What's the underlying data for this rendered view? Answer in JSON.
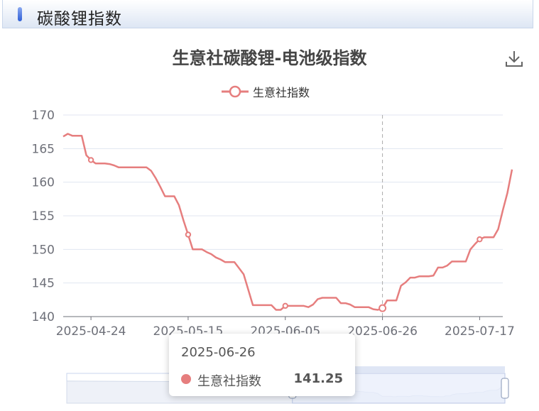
{
  "panel": {
    "title": "碳酸锂指数"
  },
  "toolbar": {
    "download_icon": "download-icon"
  },
  "colors": {
    "series": "#e67e7e",
    "grid": "#e0e6f1",
    "axis": "#6e7079",
    "crosshair": "#aaaaaa",
    "zoom_fill": "#e8eefb",
    "zoom_border": "#c8d4ec"
  },
  "chart_data": {
    "type": "line",
    "title": "生意社碳酸锂-电池级指数",
    "legend": {
      "position": "top-center",
      "entries": [
        "生意社指数"
      ]
    },
    "ylim": [
      140,
      170
    ],
    "yticks": [
      140,
      145,
      150,
      155,
      160,
      165,
      170
    ],
    "xlim": [
      "2025-04-18",
      "2025-07-22"
    ],
    "xticks": [
      "2025-04-24",
      "2025-05-15",
      "2025-06-05",
      "2025-06-26",
      "2025-07-17"
    ],
    "grid": true,
    "series": [
      {
        "name": "生意社指数",
        "symbol_dates": [
          "2025-04-24",
          "2025-05-15",
          "2025-06-05",
          "2025-06-26",
          "2025-07-17"
        ],
        "points": [
          [
            "2025-04-18",
            166.8
          ],
          [
            "2025-04-19",
            167.2
          ],
          [
            "2025-04-20",
            166.9
          ],
          [
            "2025-04-21",
            166.9
          ],
          [
            "2025-04-22",
            166.9
          ],
          [
            "2025-04-23",
            164.0
          ],
          [
            "2025-04-24",
            163.3
          ],
          [
            "2025-04-25",
            162.8
          ],
          [
            "2025-04-26",
            162.8
          ],
          [
            "2025-04-27",
            162.8
          ],
          [
            "2025-04-28",
            162.7
          ],
          [
            "2025-04-29",
            162.5
          ],
          [
            "2025-04-30",
            162.2
          ],
          [
            "2025-05-01",
            162.2
          ],
          [
            "2025-05-02",
            162.2
          ],
          [
            "2025-05-03",
            162.2
          ],
          [
            "2025-05-04",
            162.2
          ],
          [
            "2025-05-05",
            162.2
          ],
          [
            "2025-05-06",
            162.2
          ],
          [
            "2025-05-07",
            161.7
          ],
          [
            "2025-05-08",
            160.6
          ],
          [
            "2025-05-09",
            159.3
          ],
          [
            "2025-05-10",
            157.9
          ],
          [
            "2025-05-11",
            157.9
          ],
          [
            "2025-05-12",
            157.9
          ],
          [
            "2025-05-13",
            156.6
          ],
          [
            "2025-05-14",
            154.3
          ],
          [
            "2025-05-15",
            152.2
          ],
          [
            "2025-05-16",
            150.0
          ],
          [
            "2025-05-17",
            150.0
          ],
          [
            "2025-05-18",
            150.0
          ],
          [
            "2025-05-19",
            149.6
          ],
          [
            "2025-05-20",
            149.3
          ],
          [
            "2025-05-21",
            148.8
          ],
          [
            "2025-05-22",
            148.5
          ],
          [
            "2025-05-23",
            148.1
          ],
          [
            "2025-05-24",
            148.1
          ],
          [
            "2025-05-25",
            148.1
          ],
          [
            "2025-05-26",
            147.2
          ],
          [
            "2025-05-27",
            146.3
          ],
          [
            "2025-05-28",
            144.0
          ],
          [
            "2025-05-29",
            141.7
          ],
          [
            "2025-05-30",
            141.7
          ],
          [
            "2025-05-31",
            141.7
          ],
          [
            "2025-06-01",
            141.7
          ],
          [
            "2025-06-02",
            141.7
          ],
          [
            "2025-06-03",
            141.0
          ],
          [
            "2025-06-04",
            141.0
          ],
          [
            "2025-06-05",
            141.6
          ],
          [
            "2025-06-06",
            141.6
          ],
          [
            "2025-06-07",
            141.6
          ],
          [
            "2025-06-08",
            141.6
          ],
          [
            "2025-06-09",
            141.6
          ],
          [
            "2025-06-10",
            141.4
          ],
          [
            "2025-06-11",
            141.8
          ],
          [
            "2025-06-12",
            142.6
          ],
          [
            "2025-06-13",
            142.8
          ],
          [
            "2025-06-14",
            142.8
          ],
          [
            "2025-06-15",
            142.8
          ],
          [
            "2025-06-16",
            142.8
          ],
          [
            "2025-06-17",
            142.0
          ],
          [
            "2025-06-18",
            142.0
          ],
          [
            "2025-06-19",
            141.8
          ],
          [
            "2025-06-20",
            141.4
          ],
          [
            "2025-06-21",
            141.4
          ],
          [
            "2025-06-22",
            141.4
          ],
          [
            "2025-06-23",
            141.4
          ],
          [
            "2025-06-24",
            141.1
          ],
          [
            "2025-06-25",
            141.0
          ],
          [
            "2025-06-26",
            141.25
          ],
          [
            "2025-06-27",
            142.4
          ],
          [
            "2025-06-28",
            142.4
          ],
          [
            "2025-06-29",
            142.4
          ],
          [
            "2025-06-30",
            144.6
          ],
          [
            "2025-07-01",
            145.1
          ],
          [
            "2025-07-02",
            145.8
          ],
          [
            "2025-07-03",
            145.8
          ],
          [
            "2025-07-04",
            146.0
          ],
          [
            "2025-07-05",
            146.0
          ],
          [
            "2025-07-06",
            146.0
          ],
          [
            "2025-07-07",
            146.1
          ],
          [
            "2025-07-08",
            147.3
          ],
          [
            "2025-07-09",
            147.3
          ],
          [
            "2025-07-10",
            147.6
          ],
          [
            "2025-07-11",
            148.2
          ],
          [
            "2025-07-12",
            148.2
          ],
          [
            "2025-07-13",
            148.2
          ],
          [
            "2025-07-14",
            148.2
          ],
          [
            "2025-07-15",
            150.0
          ],
          [
            "2025-07-16",
            150.8
          ],
          [
            "2025-07-17",
            151.5
          ],
          [
            "2025-07-18",
            151.8
          ],
          [
            "2025-07-19",
            151.8
          ],
          [
            "2025-07-20",
            151.8
          ],
          [
            "2025-07-21",
            153.0
          ],
          [
            "2025-07-22",
            155.8
          ],
          [
            "2025-07-23",
            158.4
          ],
          [
            "2025-07-24",
            161.9
          ]
        ]
      }
    ],
    "overview": {
      "start_date": "2025-01-05",
      "selection": [
        "2025-04-18",
        "2025-07-24"
      ]
    },
    "tooltip": {
      "date": "2025-06-26",
      "series": "生意社指数",
      "value": "141.25"
    }
  }
}
